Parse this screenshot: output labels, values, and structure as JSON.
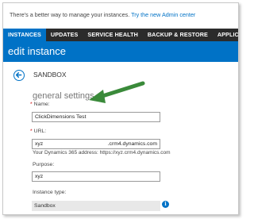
{
  "notice": {
    "text": "There's a better way to manage your instances.",
    "link": "Try the new Admin center"
  },
  "tabs": [
    {
      "label": "INSTANCES",
      "active": true
    },
    {
      "label": "UPDATES",
      "active": false
    },
    {
      "label": "SERVICE HEALTH",
      "active": false
    },
    {
      "label": "BACKUP & RESTORE",
      "active": false
    },
    {
      "label": "APPLICATIONS",
      "active": false
    }
  ],
  "page": {
    "title": "edit instance",
    "instance_name": "SANDBOX",
    "section_title": "general settings"
  },
  "form": {
    "name_label": "Name:",
    "name_value": "ClickDimensions Test",
    "url_label": "URL:",
    "url_value": "xyz",
    "url_suffix": ".crm4.dynamics.com",
    "url_hint": "Your Dynamics 365 address: https://xyz.crm4.dynamics.com",
    "purpose_label": "Purpose:",
    "purpose_value": "xyz",
    "type_label": "Instance type:",
    "type_value": "Sandbox",
    "required_mark": "*",
    "info_glyph": "i"
  },
  "colors": {
    "accent": "#0072c6",
    "tabbar": "#2b2b2b",
    "arrow": "#3a8a3a"
  },
  "icons": {
    "back": "back-arrow-icon",
    "info": "info-icon",
    "annotation": "green-arrow-icon"
  }
}
